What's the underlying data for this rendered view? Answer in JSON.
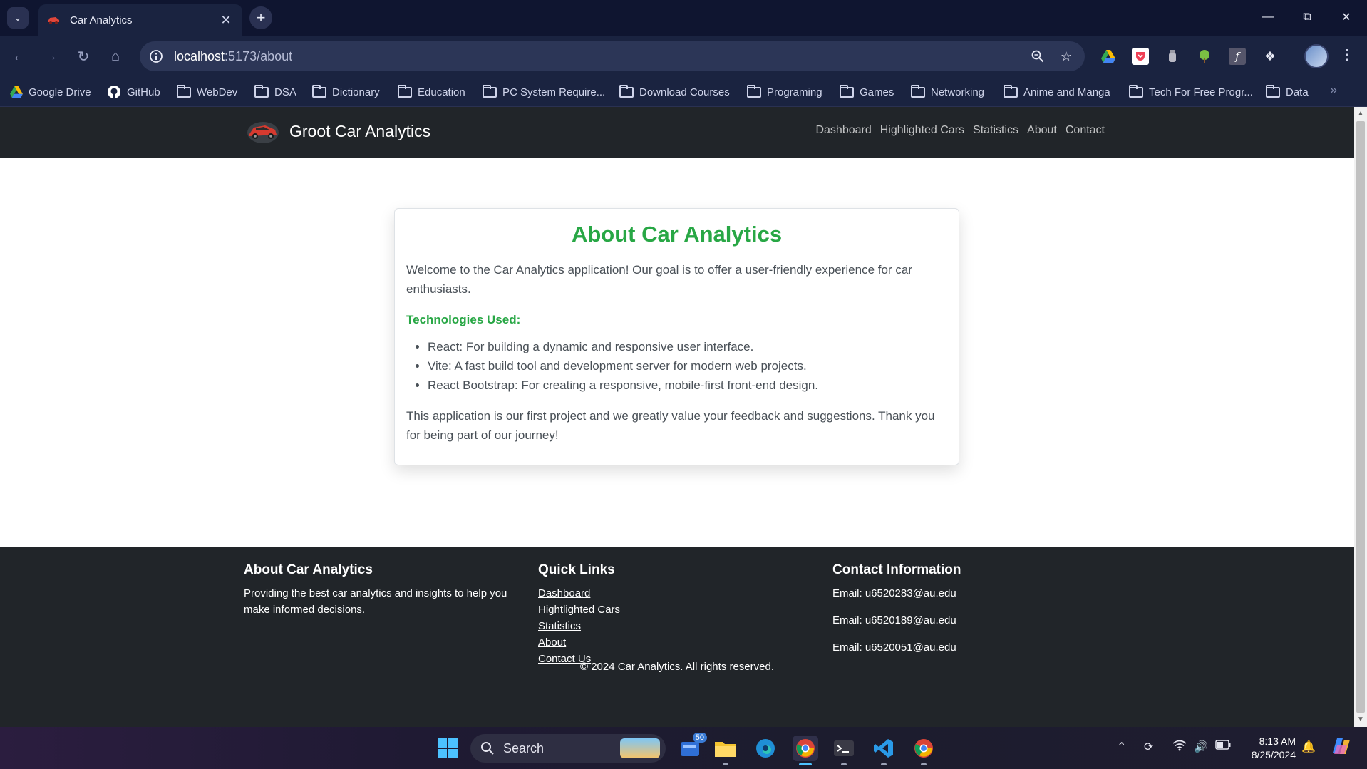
{
  "browser": {
    "tab_title": "Car Analytics",
    "url_host": "localhost",
    "url_path": ":5173/about",
    "bookmarks": [
      "Google Drive",
      "GitHub",
      "WebDev",
      "DSA",
      "Dictionary",
      "Education",
      "PC System Require...",
      "Download Courses",
      "Programing",
      "Games",
      "Networking",
      "Anime and Manga",
      "Tech For Free Progr...",
      "Data"
    ]
  },
  "site": {
    "brand": "Groot Car Analytics",
    "nav": [
      "Dashboard",
      "Highlighted Cars",
      "Statistics",
      "About",
      "Contact"
    ]
  },
  "about": {
    "title": "About Car Analytics",
    "intro": "Welcome to the Car Analytics application! Our goal is to offer a user-friendly experience for car enthusiasts.",
    "tech_heading": "Technologies Used:",
    "technologies": [
      "React: For building a dynamic and responsive user interface.",
      "Vite: A fast build tool and development server for modern web projects.",
      "React Bootstrap: For creating a responsive, mobile-first front-end design."
    ],
    "closing": "This application is our first project and we greatly value your feedback and suggestions. Thank you for being part of our journey!"
  },
  "footer": {
    "about_heading": "About Car Analytics",
    "about_text": "Providing the best car analytics and insights to help you make informed decisions.",
    "links_heading": "Quick Links",
    "links": [
      "Dashboard",
      "Hightlighted Cars",
      "Statistics",
      "About",
      "Contact Us"
    ],
    "contact_heading": "Contact Information",
    "emails": [
      "Email: u6520283@au.edu",
      "Email: u6520189@au.edu",
      "Email: u6520051@au.edu"
    ],
    "copyright": "© 2024 Car Analytics. All rights reserved."
  },
  "taskbar": {
    "search_placeholder": "Search",
    "mail_badge": "50",
    "time": "8:13 AM",
    "date": "8/25/2024"
  },
  "colors": {
    "accent_green": "#28a745",
    "navbar_dark": "#212529",
    "chrome_bg": "#0f1530"
  }
}
